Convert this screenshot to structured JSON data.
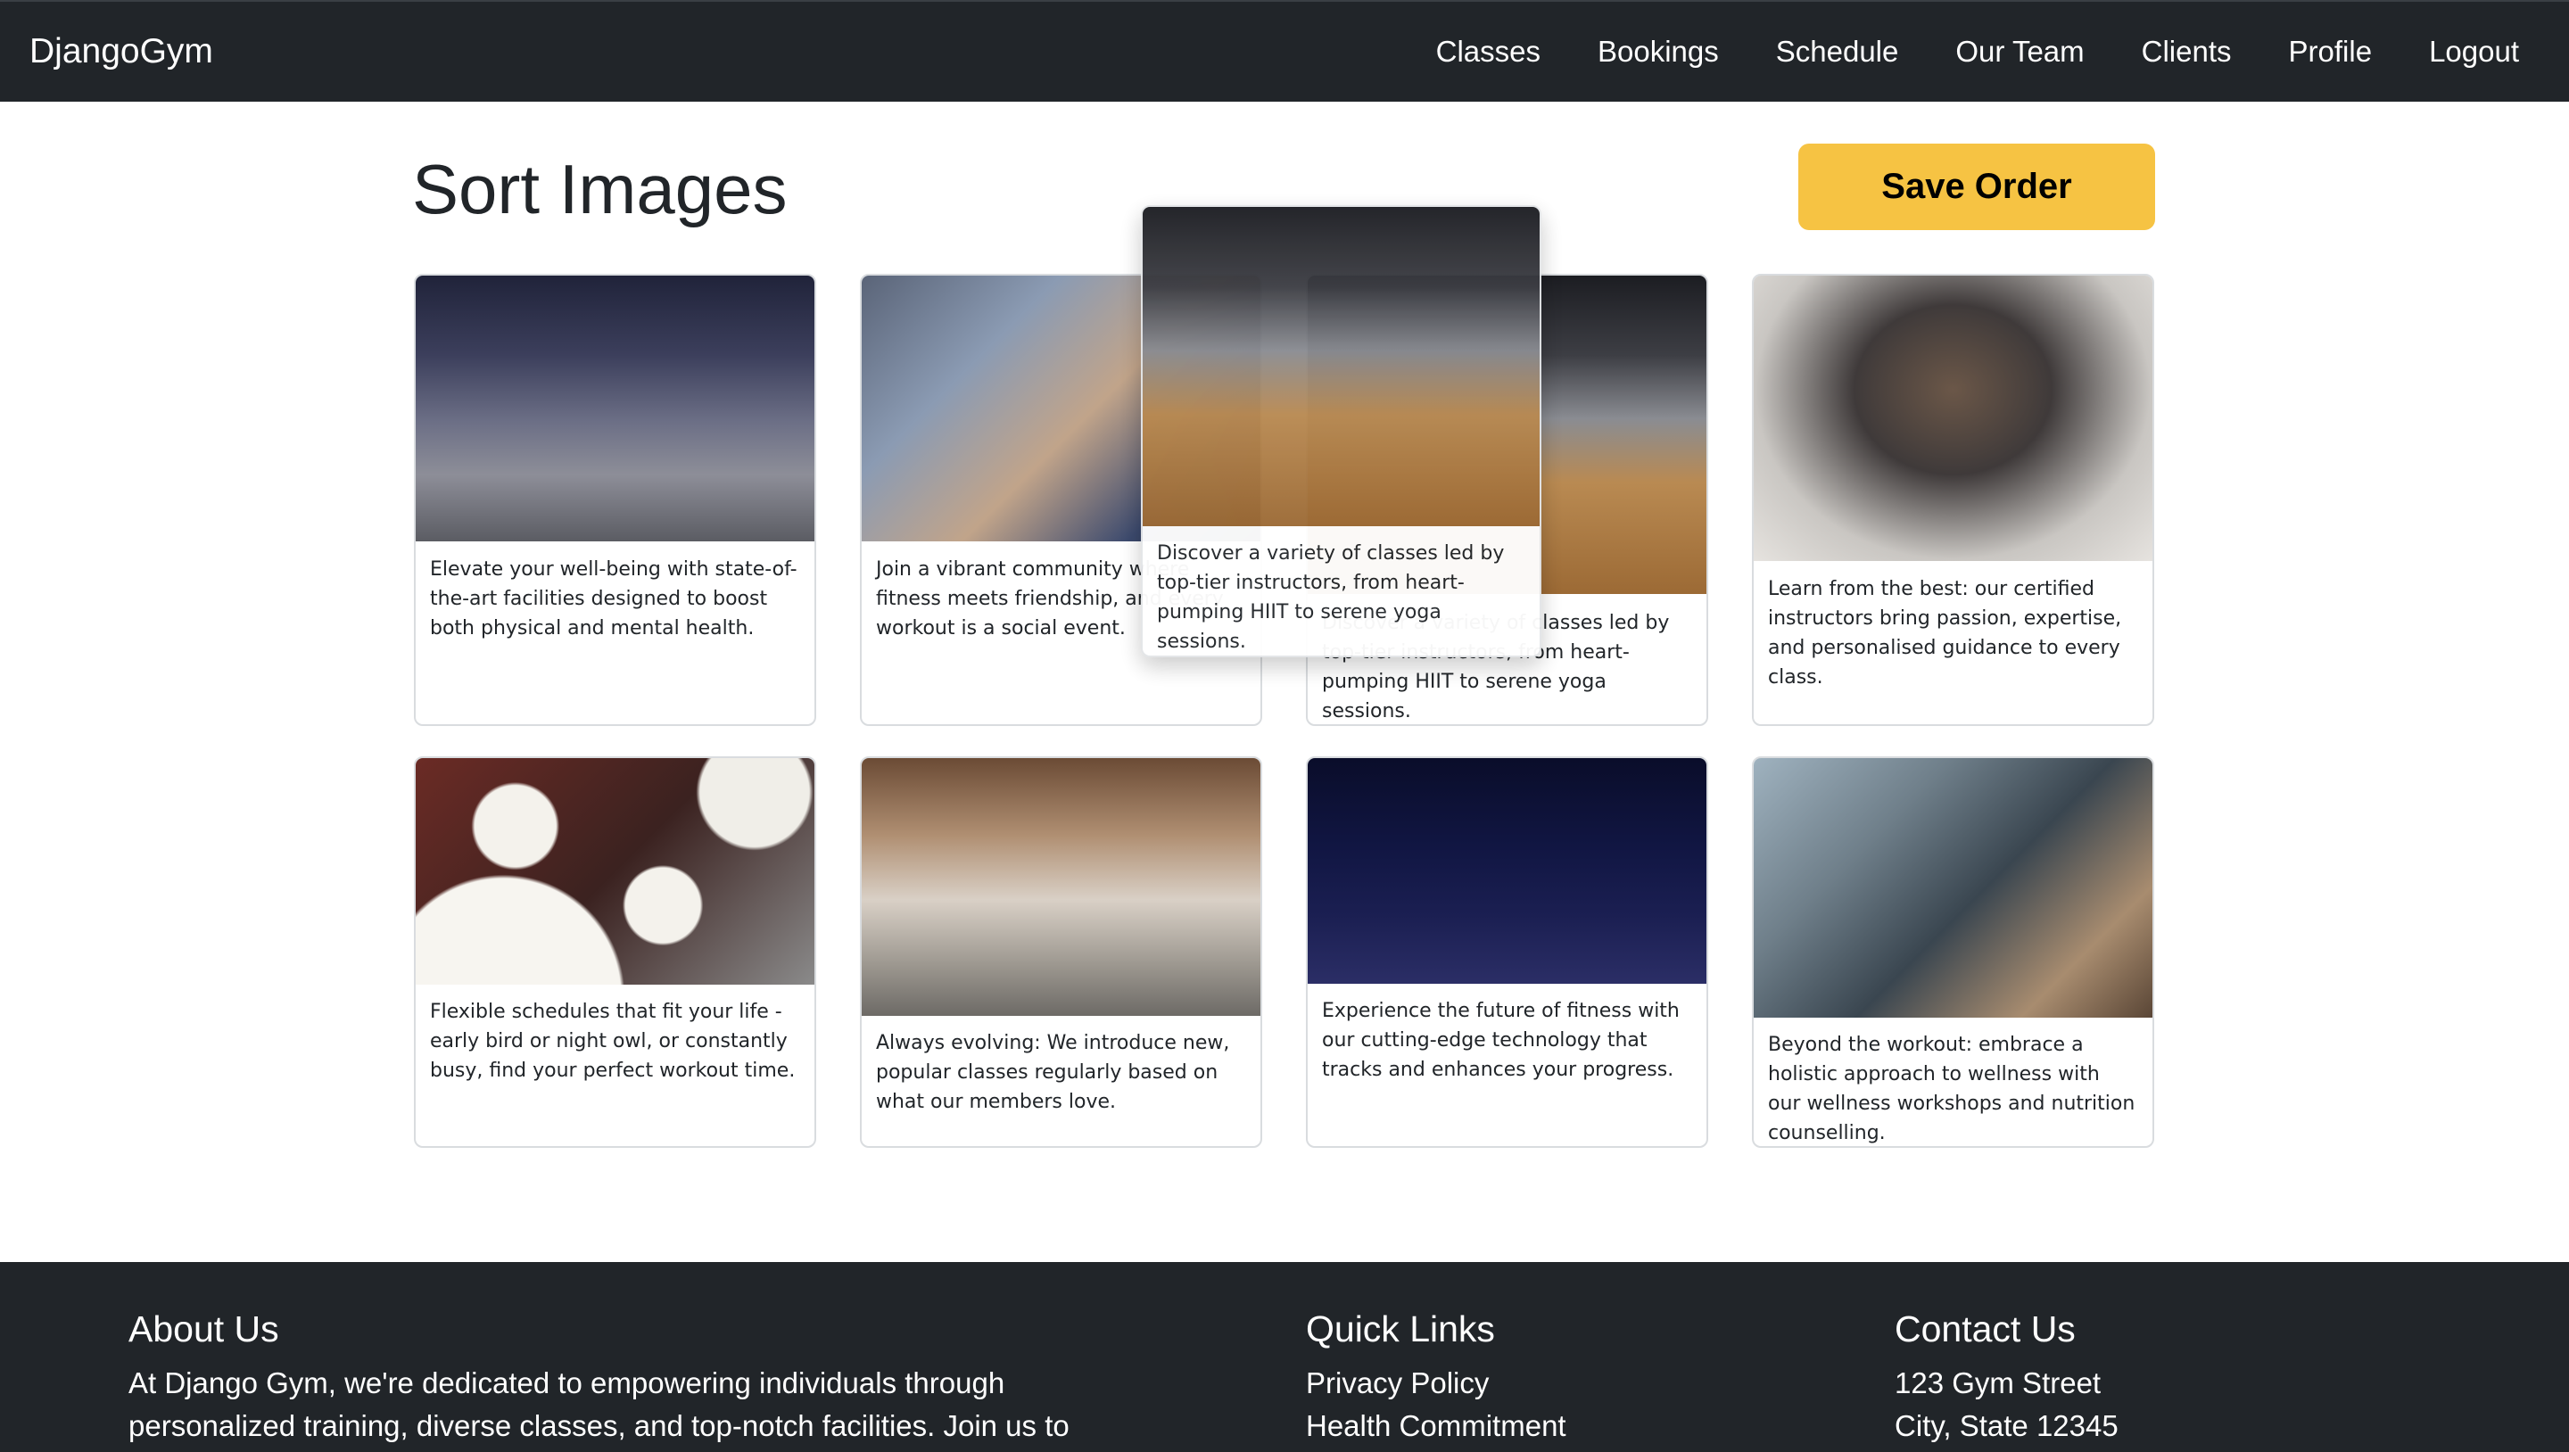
{
  "navbar": {
    "brand": "DjangoGym",
    "links": [
      "Classes",
      "Bookings",
      "Schedule",
      "Our Team",
      "Clients",
      "Profile",
      "Logout"
    ]
  },
  "page": {
    "title": "Sort Images",
    "save_label": "Save Order"
  },
  "cards": [
    {
      "image_icon": "gym-facility-image",
      "text": "Elevate your well-being with state-of-the-art facilities designed to boost both physical and mental health."
    },
    {
      "image_icon": "community-selfie-image",
      "text": "Join a vibrant community where fitness meets friendship, and every workout is a social event."
    },
    {
      "image_icon": "spin-class-image",
      "text": "Discover a variety of classes led by top-tier instructors, from heart-pumping HIIT to serene yoga sessions."
    },
    {
      "image_icon": "instructor-kettlebell-image",
      "text": "Learn from the best: our certified instructors bring passion, expertise, and personalised guidance to every class."
    },
    {
      "image_icon": "clocks-image",
      "text": "Flexible schedules that fit your life - early bird or night owl, or constantly busy, find your perfect workout time."
    },
    {
      "image_icon": "group-class-image",
      "text": "Always evolving: We introduce new, popular classes regularly based on what our members love."
    },
    {
      "image_icon": "fitness-monitor-image",
      "text": "Experience the future of fitness with our cutting-edge technology that tracks and enhances your progress."
    },
    {
      "image_icon": "wellness-consultation-image",
      "text": "Beyond the workout: embrace a holistic approach to wellness with our wellness workshops and nutrition counselling."
    }
  ],
  "dragging_card": {
    "image_icon": "spin-class-image",
    "text": "Discover a variety of classes led by top-tier instructors, from heart-pumping HIIT to serene yoga sessions."
  },
  "footer": {
    "about_title": "About Us",
    "about_text": "At Django Gym, we're dedicated to empowering individuals through personalized training, diverse classes, and top-notch facilities. Join us to",
    "quick_links_title": "Quick Links",
    "quick_links": [
      "Privacy Policy",
      "Health Commitment"
    ],
    "contact_title": "Contact Us",
    "contact_lines": [
      "123 Gym Street",
      "City, State 12345"
    ]
  },
  "colors": {
    "navbar_bg": "#212529",
    "save_button": "#f6c343",
    "footer_bg": "#212529"
  }
}
